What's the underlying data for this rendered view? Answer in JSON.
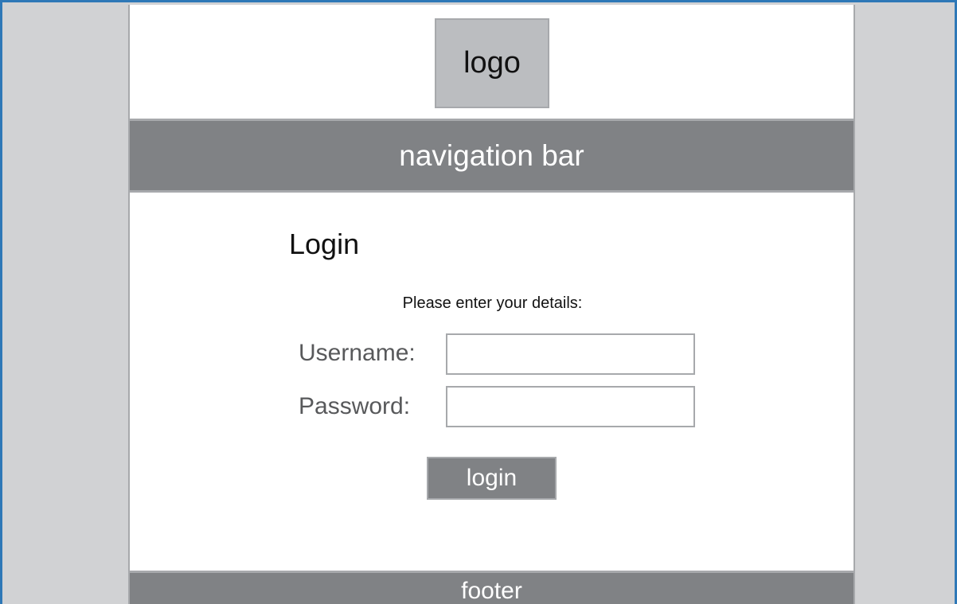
{
  "header": {
    "logo_text": "logo"
  },
  "navigation": {
    "label": "navigation bar"
  },
  "login_form": {
    "title": "Login",
    "instructions": "Please enter your details:",
    "username_label": "Username:",
    "username_value": "",
    "password_label": "Password:",
    "password_value": "",
    "submit_label": "login"
  },
  "footer": {
    "label": "footer"
  },
  "colors": {
    "frame_border": "#2e78b7",
    "side_background": "#d1d2d4",
    "bar_fill": "#808285",
    "logo_fill": "#bbbdc0",
    "outline": "#a7a9ac"
  }
}
